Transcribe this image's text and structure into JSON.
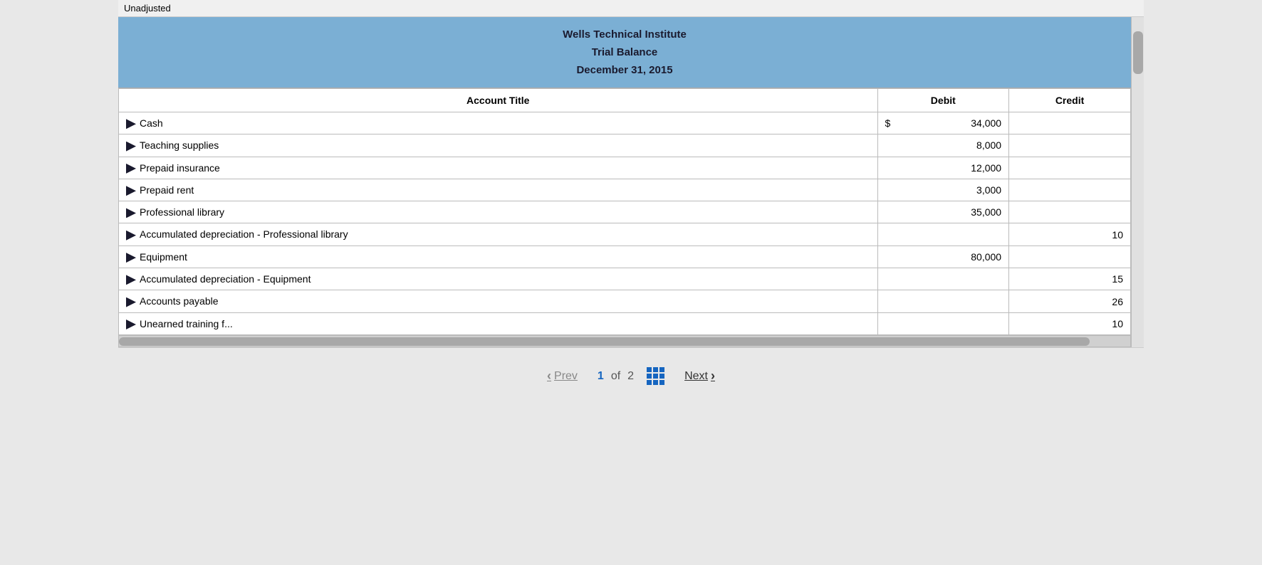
{
  "top_label": "Unadjusted",
  "report": {
    "title1": "Wells Technical Institute",
    "title2": "Trial Balance",
    "title3": "December 31, 2015"
  },
  "table": {
    "headers": {
      "account": "Account Title",
      "debit": "Debit",
      "credit": "Credit"
    },
    "rows": [
      {
        "account": "Cash",
        "debit": "$ 34,000",
        "credit": "",
        "has_dollar": true
      },
      {
        "account": "Teaching supplies",
        "debit": "8,000",
        "credit": "",
        "has_dollar": false
      },
      {
        "account": "Prepaid insurance",
        "debit": "12,000",
        "credit": "",
        "has_dollar": false
      },
      {
        "account": "Prepaid rent",
        "debit": "3,000",
        "credit": "",
        "has_dollar": false
      },
      {
        "account": "Professional library",
        "debit": "35,000",
        "credit": "",
        "has_dollar": false
      },
      {
        "account": "Accumulated depreciation - Professional library",
        "debit": "",
        "credit": "10",
        "has_dollar": false
      },
      {
        "account": "Equipment",
        "debit": "80,000",
        "credit": "",
        "has_dollar": false
      },
      {
        "account": "Accumulated depreciation - Equipment",
        "debit": "",
        "credit": "15",
        "has_dollar": false
      },
      {
        "account": "Accounts payable",
        "debit": "",
        "credit": "26",
        "has_dollar": false
      },
      {
        "account": "Unearned training f...",
        "debit": "",
        "credit": "10",
        "has_dollar": false,
        "partial": true
      }
    ]
  },
  "pagination": {
    "prev_label": "Prev",
    "next_label": "Next",
    "current_page": "1",
    "of_label": "of",
    "total_pages": "2",
    "prev_chevron": "‹",
    "next_chevron": "›"
  }
}
